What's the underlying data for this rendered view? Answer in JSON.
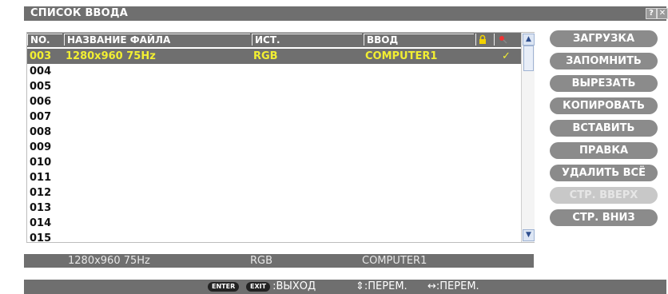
{
  "window": {
    "title": "СПИСОК ВВОДА",
    "help_label": "?",
    "close_label": "✕"
  },
  "table": {
    "headers": {
      "no": "NO.",
      "file": "НАЗВАНИЕ ФАЙЛА",
      "source": "ИСТ.",
      "input": "ВВОД"
    },
    "rows": [
      {
        "no": "003",
        "file": "1280x960 75Hz",
        "source": "RGB",
        "input": "COMPUTER1",
        "check": "✓",
        "selected": true
      },
      {
        "no": "004"
      },
      {
        "no": "005"
      },
      {
        "no": "006"
      },
      {
        "no": "007"
      },
      {
        "no": "008"
      },
      {
        "no": "009"
      },
      {
        "no": "010"
      },
      {
        "no": "011"
      },
      {
        "no": "012"
      },
      {
        "no": "013"
      },
      {
        "no": "014"
      },
      {
        "no": "015"
      }
    ]
  },
  "buttons": {
    "load": "ЗАГРУЗКА",
    "save": "ЗАПОМНИТЬ",
    "cut": "ВЫРЕЗАТЬ",
    "copy": "КОПИРОВАТЬ",
    "paste": "ВСТАВИТЬ",
    "edit": "ПРАВКА",
    "delete_all": "УДАЛИТЬ ВСЁ",
    "page_up": "СТР. ВВЕРХ",
    "page_down": "СТР. ВНИЗ"
  },
  "status": {
    "file": "1280x960 75Hz",
    "source": "RGB",
    "input": "COMPUTER1"
  },
  "footer": {
    "enter_key": "ENTER",
    "exit_key": "EXIT",
    "exit_label": ":ВЫХОД",
    "move_v": "⇕:ПЕРЕМ.",
    "move_h": "↔:ПЕРЕМ."
  }
}
